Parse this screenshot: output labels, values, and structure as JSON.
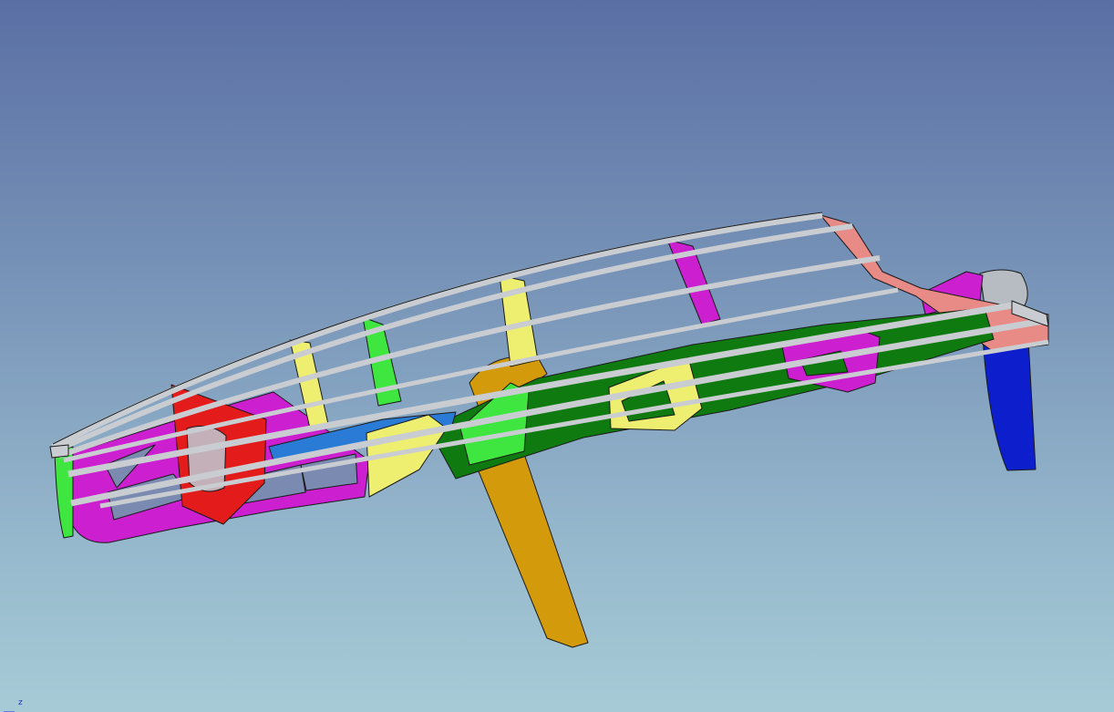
{
  "viewport": {
    "background_top": "#5a6fa4",
    "background_bottom": "#a7cbd6"
  },
  "model": {
    "description_visible": false,
    "part_colors": {
      "frame_grey": "#c9cdd2",
      "magenta": "#cc1fd0",
      "red": "#e31b1b",
      "yellow": "#eeee70",
      "green": "#0f7a0f",
      "lime": "#3fe63f",
      "orange": "#d39a0c",
      "blue": "#0d1fcc",
      "salmon": "#e88a86",
      "sky_blue": "#2a7bd6"
    }
  },
  "axis_triad": {
    "z_label": "z"
  }
}
